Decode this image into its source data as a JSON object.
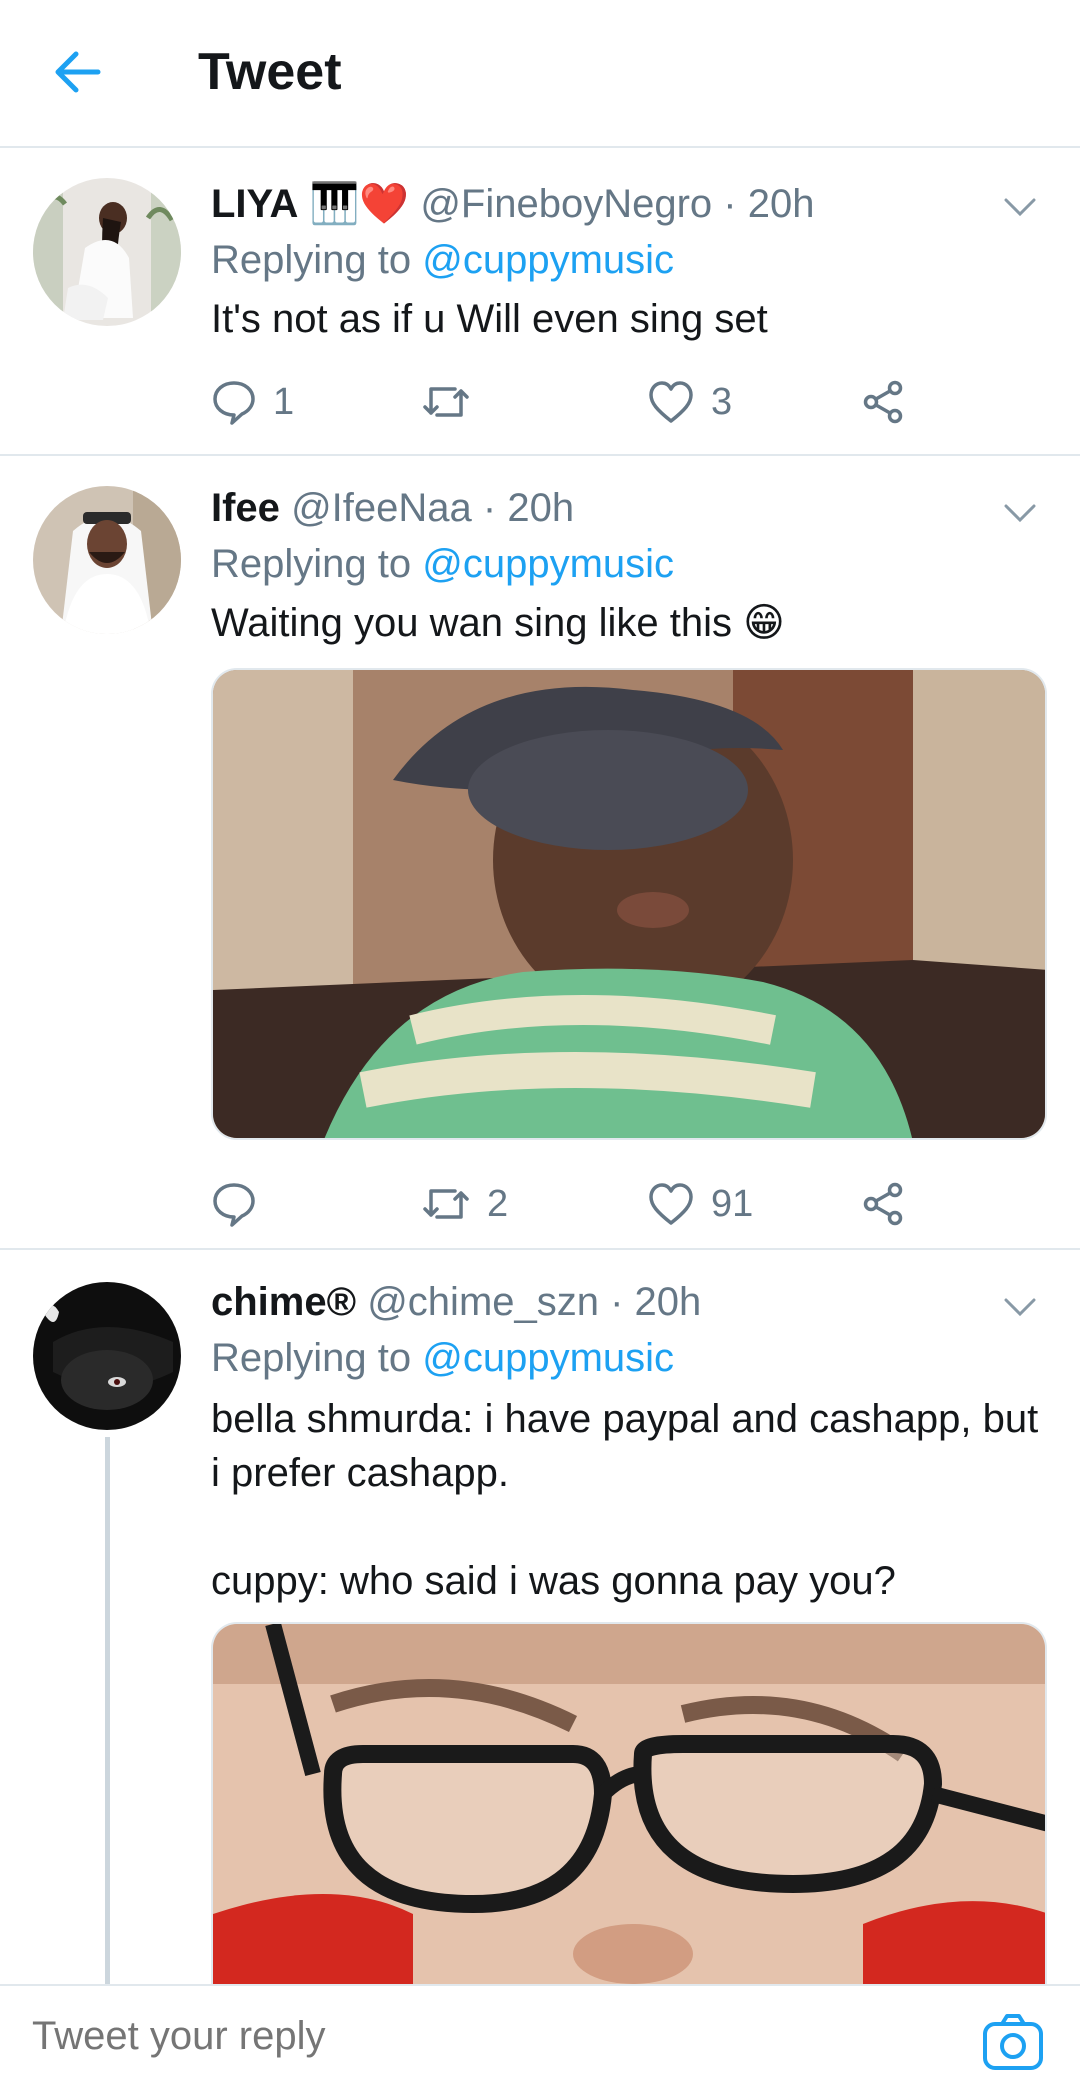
{
  "header": {
    "title": "Tweet"
  },
  "tweets": [
    {
      "name": "LIYA",
      "emoji": "🎹❤️",
      "handle": "@FineboyNegro",
      "time": "· 20h",
      "replying_label": "Replying to",
      "replying_to": "@cuppymusic",
      "text": "It's not as if u Will even sing set",
      "reply_count": "1",
      "retweet_count": "",
      "like_count": "3"
    },
    {
      "name": "Ifee",
      "handle": "@IfeeNaa",
      "time": "· 20h",
      "replying_label": "Replying to",
      "replying_to": "@cuppymusic",
      "text": "Waiting you wan sing like this",
      "emoji": "😁",
      "reply_count": "",
      "retweet_count": "2",
      "like_count": "91"
    },
    {
      "name": "chime®",
      "handle": "@chime_szn",
      "time": "· 20h",
      "replying_label": "Replying to",
      "replying_to": "@cuppymusic",
      "text_line1": "bella shmurda: i have paypal and cashapp, but",
      "text_line2": "i prefer cashapp.",
      "text_line3": "cuppy: who said i was gonna pay you?"
    }
  ],
  "reply_bar": {
    "placeholder": "Tweet your reply"
  },
  "colors": {
    "accent": "#1da1f2",
    "muted": "#657786",
    "divider": "#e1e8ed"
  }
}
